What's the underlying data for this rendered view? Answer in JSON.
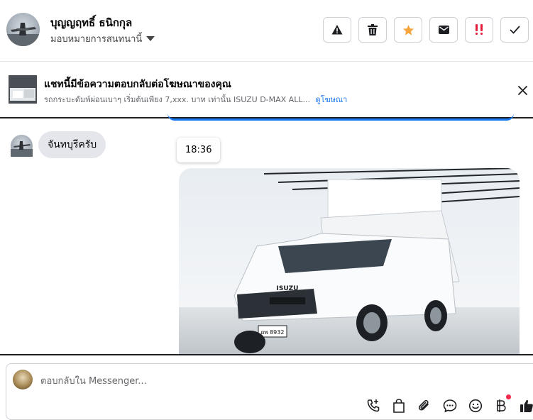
{
  "header": {
    "contact_name": "บุญญฤทธิ์ ธนิกกุล",
    "assign_label": "มอบหมายการสนทนานี้",
    "actions": [
      {
        "name": "report-icon",
        "color": "#1c1e21"
      },
      {
        "name": "trash-icon",
        "color": "#1c1e21"
      },
      {
        "name": "star-icon",
        "color": "#f5a53c"
      },
      {
        "name": "mail-icon",
        "color": "#1c1e21"
      },
      {
        "name": "priority-icon",
        "color": "#e41e3f"
      },
      {
        "name": "check-icon",
        "color": "#1c1e21"
      }
    ]
  },
  "ad_banner": {
    "title": "แชทนี้มีข้อความตอบกลับต่อโฆษณาของคุณ",
    "subtitle": "รถกระบะดัมพ์ผ่อนเบาๆ เริ่มต้นเพียง 7,xxx. บาท เท่านั้น ISUZU D-MAX ALL...",
    "link_label": "ดูโฆษณา",
    "close_icon": "close-icon"
  },
  "conversation": {
    "incoming_message": "จันทบุรีครับ",
    "timestamp": "18:36",
    "photo_plate": "ผพ 8932",
    "photo_brand": "ISUZU"
  },
  "composer": {
    "placeholder": "ตอบกลับใน Messenger...",
    "tools": [
      "call-add-icon",
      "bag-icon",
      "paperclip-icon",
      "chat-bubble-icon",
      "emoji-icon",
      "baht-icon",
      "thumbs-up-icon"
    ]
  },
  "colors": {
    "accent": "#1877f2",
    "star": "#f5a53c",
    "alert": "#e41e3f",
    "notification_dot": "#f02849"
  }
}
